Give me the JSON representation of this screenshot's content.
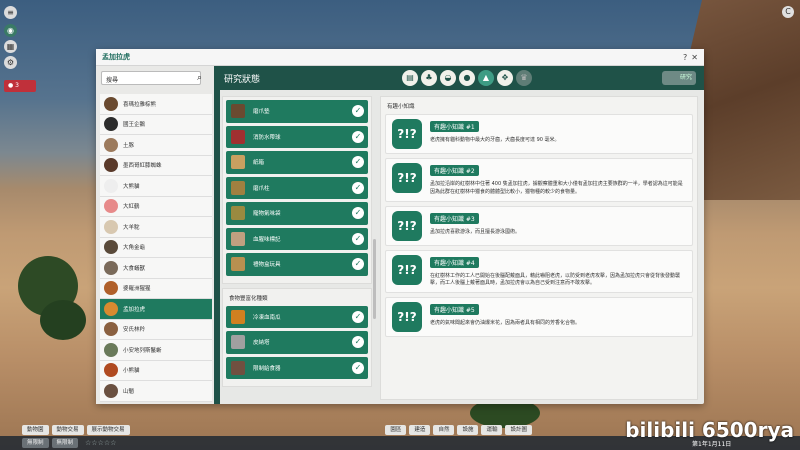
{
  "window": {
    "title": "孟加拉虎",
    "help_label": "?",
    "close_label": "✕"
  },
  "search": {
    "value": "搜尋",
    "icon": "search-icon"
  },
  "animals": [
    {
      "label": "喜瑪拉雅棕熊",
      "color": "#6a4a30"
    },
    {
      "label": "國王企鵝",
      "color": "#2c2c2c"
    },
    {
      "label": "土豚",
      "color": "#9c7a5c"
    },
    {
      "label": "墨西哥紅膝蜘蛛",
      "color": "#5a3a2a"
    },
    {
      "label": "大熊貓",
      "color": "#eeeeee"
    },
    {
      "label": "大紅鶴",
      "color": "#e78a8a"
    },
    {
      "label": "大羊駝",
      "color": "#d8c8b0"
    },
    {
      "label": "大角金龜",
      "color": "#5a4a3a"
    },
    {
      "label": "大食蟻獸",
      "color": "#7a6a5a"
    },
    {
      "label": "婆羅洲猩猩",
      "color": "#b0602a"
    },
    {
      "label": "孟加拉虎",
      "color": "#d88a30",
      "selected": true
    },
    {
      "label": "安氏林羚",
      "color": "#8a6040"
    },
    {
      "label": "小安地列斯鬣蜥",
      "color": "#6a7a5a"
    },
    {
      "label": "小熊貓",
      "color": "#b04a20"
    },
    {
      "label": "山魈",
      "color": "#6a5040"
    }
  ],
  "header": {
    "title": "研究狀態",
    "tabs": [
      {
        "icon": "book-icon",
        "glyph": "▤"
      },
      {
        "icon": "tree-icon",
        "glyph": "♣"
      },
      {
        "icon": "food-bag-icon",
        "glyph": "◒"
      },
      {
        "icon": "egg-icon",
        "glyph": "●"
      },
      {
        "icon": "mountain-icon",
        "glyph": "▲",
        "active": true
      },
      {
        "icon": "paw-icon",
        "glyph": "✥"
      },
      {
        "icon": "trophy-icon",
        "glyph": "♛",
        "disabled": true
      }
    ],
    "right_button": "研究"
  },
  "enrichment_items": [
    {
      "label": "磨爪墊",
      "color": "#6a4a30"
    },
    {
      "label": "消防水帶球",
      "color": "#a03030"
    },
    {
      "label": "紙箱",
      "color": "#c8a060"
    },
    {
      "label": "磨爪柱",
      "color": "#a08040"
    },
    {
      "label": "寵物氣味袋",
      "color": "#9a8a40"
    },
    {
      "label": "血腥味標記",
      "color": "#c0a080"
    },
    {
      "label": "禮物盒玩具",
      "color": "#b89050"
    }
  ],
  "food_group": {
    "title": "食物豐富化種類",
    "items": [
      {
        "label": "冷凍血南瓜",
        "color": "#d08020"
      },
      {
        "label": "皮納塔",
        "color": "#a0a0a0"
      },
      {
        "label": "限制給食器",
        "color": "#705040"
      }
    ]
  },
  "facts_panel": {
    "title": "有趣小知識",
    "bubble_glyph": "?!?",
    "facts": [
      {
        "title": "有趣小知識 #1",
        "text": "老虎擁有貓科動物中最大的牙齒，犬齒長度可達 90 毫米。"
      },
      {
        "title": "有趣小知識 #2",
        "text": "孟加拉沿岸的紅樹林中住著 400 隻孟加拉虎，據觀察體重和大小僅有孟加拉虎主要族群的一半，學者認為這可能是因為此群在紅樹林中獵食的體體型比較小，獵物種的較少的食物量。"
      },
      {
        "title": "有趣小知識 #3",
        "text": "孟加拉虎喜歡游泳，而且擅長游泳國術。"
      },
      {
        "title": "有趣小知識 #4",
        "text": "在紅樹林工作的工人已開始在後腦配戴面具，藉此嚇阻老虎，以防受到老虎攻擊，因為孟加拉虎只會從背後發動襲擊，而工人後腦上戴著面具時，孟加拉虎會以為自己受到注意而不敢攻擊。"
      },
      {
        "title": "有趣小知識 #5",
        "text": "老虎的氣味聞起來會仍油爆米花，因為兩者具有相同的芳香化合物。"
      }
    ]
  },
  "hud": {
    "alert_count": "3",
    "top_right": "C"
  },
  "bottom_row1": [
    "動物園",
    "動物交易",
    "園區",
    "建造",
    "自然",
    "設施",
    "運輸",
    "設計圖"
  ],
  "bottom_row1_extra": "展示動物交易",
  "bottom_row2": [
    "無限制",
    "無限制"
  ],
  "status": {
    "stars": "☆☆☆☆☆",
    "date": "第1年1月11日"
  },
  "watermark": "bilibili 6500rya",
  "colors": {
    "primary_green": "#1f7a5f",
    "header_green": "#1f5248"
  }
}
